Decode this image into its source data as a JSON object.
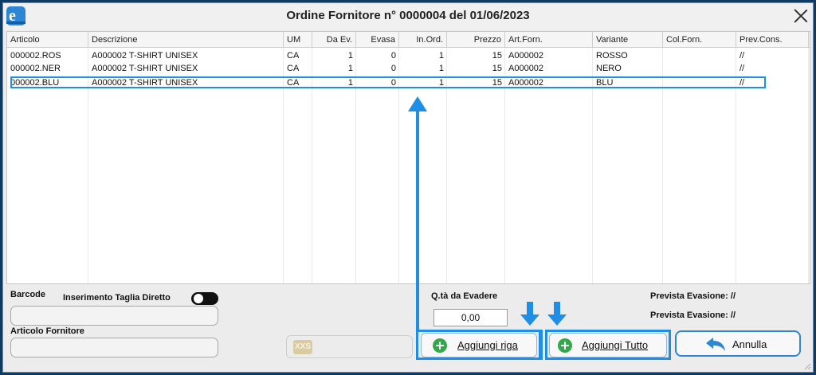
{
  "window": {
    "title": "Ordine Fornitore n° 0000004 del 01/06/2023"
  },
  "colors": {
    "accent": "#1f8ee6",
    "add_icon": "#32a84a",
    "undo_icon": "#2f86d4",
    "background": "#0f3a63"
  },
  "icons": {
    "app": "app-logo-icon",
    "close": "close-icon",
    "add": "plus-circle-icon",
    "undo": "undo-arrow-icon",
    "size": "xxs-size-icon"
  },
  "grid": {
    "columns": [
      "Articolo",
      "Descrizione",
      "UM",
      "Da Ev.",
      "Evasa",
      "In.Ord.",
      "Prezzo",
      "Art.Forn.",
      "Variante",
      "Col.Forn.",
      "Prev.Cons."
    ],
    "rows": [
      [
        "000002.ROS",
        "A000002 T-SHIRT UNISEX",
        "CA",
        "1",
        "0",
        "1",
        "15",
        "A000002",
        "ROSSO",
        "",
        "//"
      ],
      [
        "000002.NER",
        "A000002 T-SHIRT UNISEX",
        "CA",
        "1",
        "0",
        "1",
        "15",
        "A000002",
        "NERO",
        "",
        "//"
      ],
      [
        "000002.BLU",
        "A000002 T-SHIRT UNISEX",
        "CA",
        "1",
        "0",
        "1",
        "15",
        "A000002",
        "BLU",
        "",
        "//"
      ]
    ],
    "selected_row": 2
  },
  "form": {
    "barcode_label": "Barcode",
    "barcode_value": "",
    "direct_size_label": "Inserimento Taglia Diretto",
    "supplier_article_label": "Articolo Fornitore",
    "supplier_article_value": "",
    "qty_label": "Q.tà da Evadere",
    "qty_value": "0,00",
    "prev_evasione_1": "Prevista Evasione: //",
    "prev_evasione_2": "Prevista Evasione: //"
  },
  "buttons": {
    "size_icon_label": "XXS",
    "add_row": "Aggiungi riga",
    "add_all": "Aggiungi Tutto",
    "cancel": "Annulla"
  }
}
